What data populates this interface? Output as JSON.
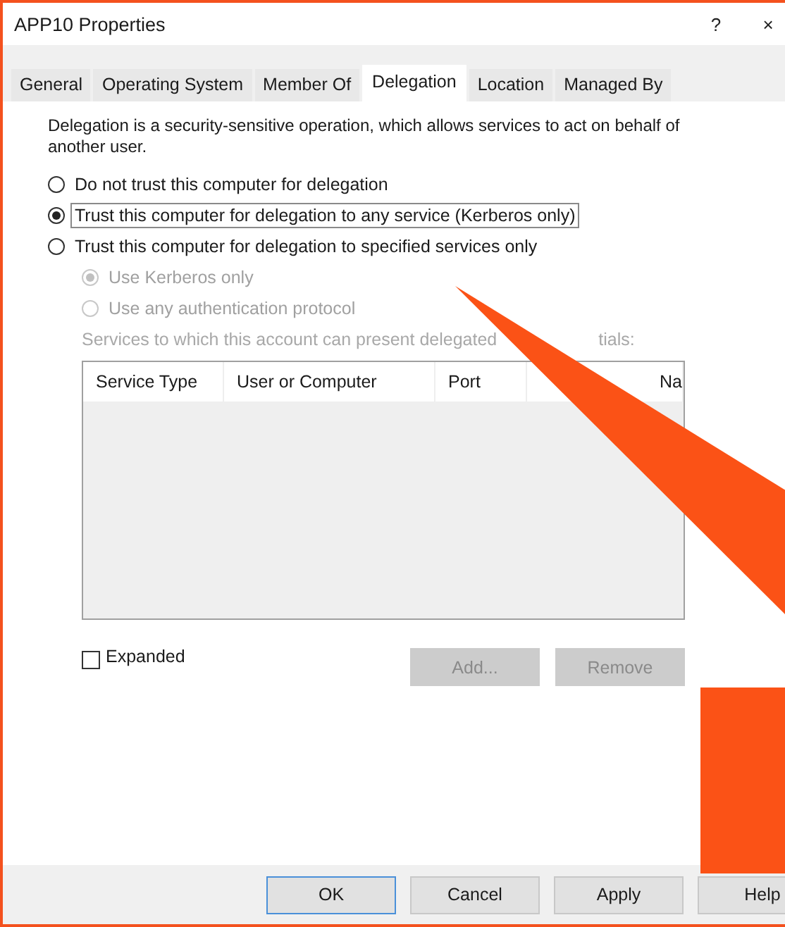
{
  "window": {
    "title": "APP10 Properties",
    "help": "?",
    "close": "×"
  },
  "tabs": [
    {
      "label": "General",
      "selected": false
    },
    {
      "label": "Operating System",
      "selected": false
    },
    {
      "label": "Member Of",
      "selected": false
    },
    {
      "label": "Delegation",
      "selected": true
    },
    {
      "label": "Location",
      "selected": false
    },
    {
      "label": "Managed By",
      "selected": false
    }
  ],
  "description": "Delegation is a security-sensitive operation, which allows services to act on behalf of another user.",
  "trust_options": [
    {
      "label": "Do not trust this computer for delegation",
      "selected": false,
      "focused": false
    },
    {
      "label": "Trust this computer for delegation to any service (Kerberos only)",
      "selected": true,
      "focused": true
    },
    {
      "label": "Trust this computer for delegation to specified services only",
      "selected": false,
      "focused": false
    }
  ],
  "protocol_options": [
    {
      "label": "Use Kerberos only",
      "selected": true,
      "disabled": true
    },
    {
      "label": "Use any authentication protocol",
      "selected": false,
      "disabled": true
    }
  ],
  "services_label": {
    "before": "Services to which this account can present delegated",
    "after": "tials:"
  },
  "table": {
    "columns": [
      "Service Type",
      "User or Computer",
      "Port",
      "Na"
    ]
  },
  "expanded": {
    "label": "Expanded",
    "checked": false
  },
  "list_buttons": [
    {
      "label": "Add...",
      "disabled": true
    },
    {
      "label": "Remove",
      "disabled": true
    }
  ],
  "buttons": [
    {
      "label": "OK",
      "default": true
    },
    {
      "label": "Cancel",
      "default": false
    },
    {
      "label": "Apply",
      "default": false
    },
    {
      "label": "Help",
      "default": false
    }
  ]
}
